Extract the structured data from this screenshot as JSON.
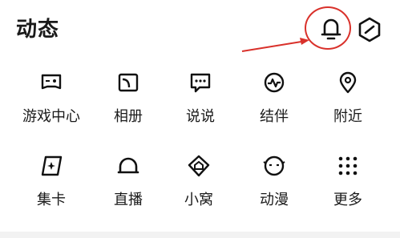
{
  "header": {
    "title": "动态",
    "bell_icon": "bell-icon",
    "badge_icon": "hexagon-slash-icon"
  },
  "annotation": {
    "color": "#d9312b"
  },
  "grid": {
    "items": [
      {
        "label": "游戏中心",
        "icon": "game-center-icon"
      },
      {
        "label": "相册",
        "icon": "photo-album-icon"
      },
      {
        "label": "说说",
        "icon": "chat-bubble-icon"
      },
      {
        "label": "结伴",
        "icon": "partner-pulse-icon"
      },
      {
        "label": "附近",
        "icon": "location-pin-icon"
      },
      {
        "label": "集卡",
        "icon": "card-collect-icon"
      },
      {
        "label": "直播",
        "icon": "live-arch-icon"
      },
      {
        "label": "小窝",
        "icon": "home-nest-icon"
      },
      {
        "label": "动漫",
        "icon": "anime-face-icon"
      },
      {
        "label": "更多",
        "icon": "more-grid-icon"
      }
    ]
  }
}
